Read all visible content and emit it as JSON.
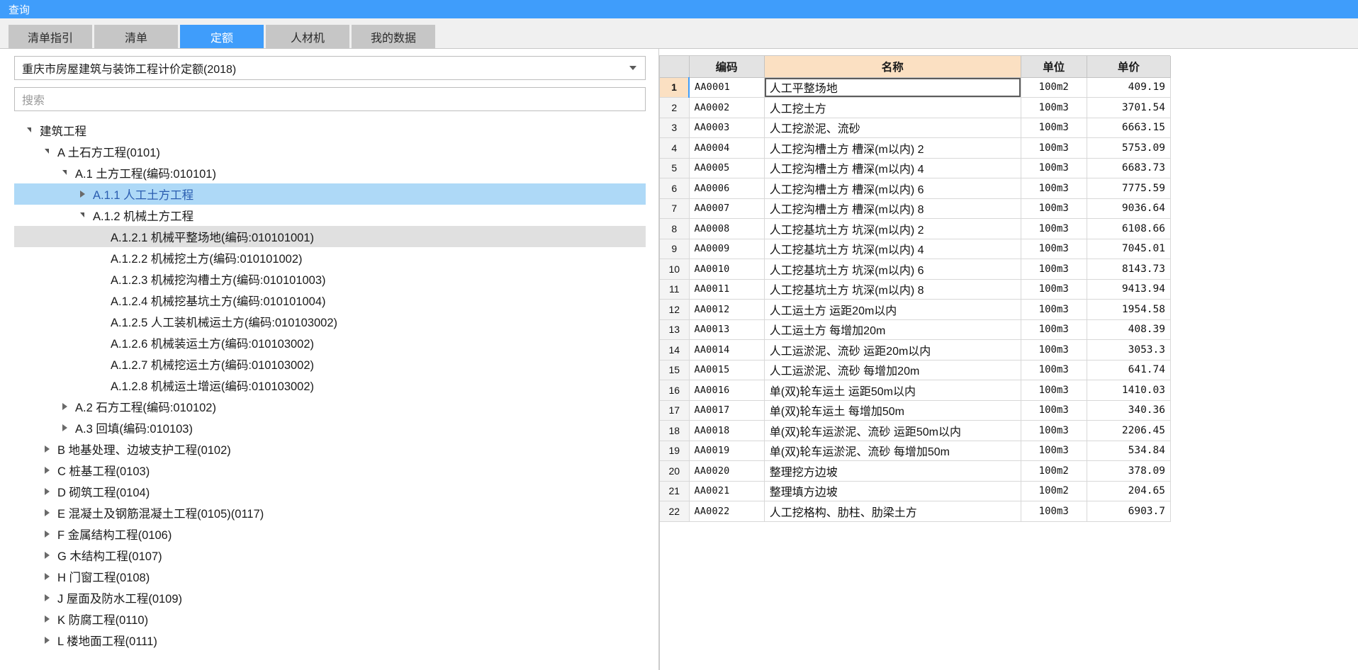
{
  "window": {
    "title": "查询"
  },
  "tabs": [
    {
      "label": "清单指引",
      "active": false
    },
    {
      "label": "清单",
      "active": false
    },
    {
      "label": "定额",
      "active": true
    },
    {
      "label": "人材机",
      "active": false
    },
    {
      "label": "我的数据",
      "active": false
    }
  ],
  "left": {
    "library_select": {
      "value": "重庆市房屋建筑与装饰工程计价定额(2018)",
      "caret_icon": "chevron-down-icon"
    },
    "search": {
      "value": "",
      "placeholder": "搜索"
    },
    "tree": [
      {
        "label": "建筑工程",
        "indent": 0,
        "twist": "down",
        "state": "normal"
      },
      {
        "label": "A 土石方工程(0101)",
        "indent": 1,
        "twist": "down",
        "state": "normal"
      },
      {
        "label": "A.1 土方工程(编码:010101)",
        "indent": 2,
        "twist": "down",
        "state": "normal"
      },
      {
        "label": "A.1.1 人工土方工程",
        "indent": 3,
        "twist": "right",
        "state": "selected"
      },
      {
        "label": "A.1.2 机械土方工程",
        "indent": 3,
        "twist": "down",
        "state": "normal"
      },
      {
        "label": "A.1.2.1 机械平整场地(编码:010101001)",
        "indent": 4,
        "twist": "none",
        "state": "highlight"
      },
      {
        "label": "A.1.2.2 机械挖土方(编码:010101002)",
        "indent": 4,
        "twist": "none",
        "state": "normal"
      },
      {
        "label": "A.1.2.3 机械挖沟槽土方(编码:010101003)",
        "indent": 4,
        "twist": "none",
        "state": "normal"
      },
      {
        "label": "A.1.2.4 机械挖基坑土方(编码:010101004)",
        "indent": 4,
        "twist": "none",
        "state": "normal"
      },
      {
        "label": "A.1.2.5 人工装机械运土方(编码:010103002)",
        "indent": 4,
        "twist": "none",
        "state": "normal"
      },
      {
        "label": "A.1.2.6 机械装运土方(编码:010103002)",
        "indent": 4,
        "twist": "none",
        "state": "normal"
      },
      {
        "label": "A.1.2.7 机械挖运土方(编码:010103002)",
        "indent": 4,
        "twist": "none",
        "state": "normal"
      },
      {
        "label": "A.1.2.8 机械运土增运(编码:010103002)",
        "indent": 4,
        "twist": "none",
        "state": "normal"
      },
      {
        "label": "A.2 石方工程(编码:010102)",
        "indent": 2,
        "twist": "right",
        "state": "normal"
      },
      {
        "label": "A.3 回填(编码:010103)",
        "indent": 2,
        "twist": "right",
        "state": "normal"
      },
      {
        "label": "B 地基处理、边坡支护工程(0102)",
        "indent": 1,
        "twist": "right",
        "state": "normal"
      },
      {
        "label": "C 桩基工程(0103)",
        "indent": 1,
        "twist": "right",
        "state": "normal"
      },
      {
        "label": "D 砌筑工程(0104)",
        "indent": 1,
        "twist": "right",
        "state": "normal"
      },
      {
        "label": "E 混凝土及钢筋混凝土工程(0105)(0117)",
        "indent": 1,
        "twist": "right",
        "state": "normal"
      },
      {
        "label": "F 金属结构工程(0106)",
        "indent": 1,
        "twist": "right",
        "state": "normal"
      },
      {
        "label": "G 木结构工程(0107)",
        "indent": 1,
        "twist": "right",
        "state": "normal"
      },
      {
        "label": "H 门窗工程(0108)",
        "indent": 1,
        "twist": "right",
        "state": "normal"
      },
      {
        "label": "J 屋面及防水工程(0109)",
        "indent": 1,
        "twist": "right",
        "state": "normal"
      },
      {
        "label": "K 防腐工程(0110)",
        "indent": 1,
        "twist": "right",
        "state": "normal"
      },
      {
        "label": "L 楼地面工程(0111)",
        "indent": 1,
        "twist": "right",
        "state": "normal"
      }
    ]
  },
  "grid": {
    "columns": [
      "",
      "编码",
      "名称",
      "单位",
      "单价"
    ],
    "selected_row": 1,
    "rows": [
      {
        "n": "1",
        "code": "AA0001",
        "name": "人工平整场地",
        "unit": "100m2",
        "price": "409.19"
      },
      {
        "n": "2",
        "code": "AA0002",
        "name": "人工挖土方",
        "unit": "100m3",
        "price": "3701.54"
      },
      {
        "n": "3",
        "code": "AA0003",
        "name": "人工挖淤泥、流砂",
        "unit": "100m3",
        "price": "6663.15"
      },
      {
        "n": "4",
        "code": "AA0004",
        "name": "人工挖沟槽土方 槽深(m以内) 2",
        "unit": "100m3",
        "price": "5753.09"
      },
      {
        "n": "5",
        "code": "AA0005",
        "name": "人工挖沟槽土方 槽深(m以内) 4",
        "unit": "100m3",
        "price": "6683.73"
      },
      {
        "n": "6",
        "code": "AA0006",
        "name": "人工挖沟槽土方 槽深(m以内) 6",
        "unit": "100m3",
        "price": "7775.59"
      },
      {
        "n": "7",
        "code": "AA0007",
        "name": "人工挖沟槽土方 槽深(m以内) 8",
        "unit": "100m3",
        "price": "9036.64"
      },
      {
        "n": "8",
        "code": "AA0008",
        "name": "人工挖基坑土方 坑深(m以内) 2",
        "unit": "100m3",
        "price": "6108.66"
      },
      {
        "n": "9",
        "code": "AA0009",
        "name": "人工挖基坑土方 坑深(m以内) 4",
        "unit": "100m3",
        "price": "7045.01"
      },
      {
        "n": "10",
        "code": "AA0010",
        "name": "人工挖基坑土方 坑深(m以内) 6",
        "unit": "100m3",
        "price": "8143.73"
      },
      {
        "n": "11",
        "code": "AA0011",
        "name": "人工挖基坑土方 坑深(m以内) 8",
        "unit": "100m3",
        "price": "9413.94"
      },
      {
        "n": "12",
        "code": "AA0012",
        "name": "人工运土方 运距20m以内",
        "unit": "100m3",
        "price": "1954.58"
      },
      {
        "n": "13",
        "code": "AA0013",
        "name": "人工运土方 每增加20m",
        "unit": "100m3",
        "price": "408.39"
      },
      {
        "n": "14",
        "code": "AA0014",
        "name": "人工运淤泥、流砂 运距20m以内",
        "unit": "100m3",
        "price": "3053.3"
      },
      {
        "n": "15",
        "code": "AA0015",
        "name": "人工运淤泥、流砂 每增加20m",
        "unit": "100m3",
        "price": "641.74"
      },
      {
        "n": "16",
        "code": "AA0016",
        "name": "单(双)轮车运土 运距50m以内",
        "unit": "100m3",
        "price": "1410.03"
      },
      {
        "n": "17",
        "code": "AA0017",
        "name": "单(双)轮车运土 每增加50m",
        "unit": "100m3",
        "price": "340.36"
      },
      {
        "n": "18",
        "code": "AA0018",
        "name": "单(双)轮车运淤泥、流砂 运距50m以内",
        "unit": "100m3",
        "price": "2206.45"
      },
      {
        "n": "19",
        "code": "AA0019",
        "name": "单(双)轮车运淤泥、流砂 每增加50m",
        "unit": "100m3",
        "price": "534.84"
      },
      {
        "n": "20",
        "code": "AA0020",
        "name": "整理挖方边坡",
        "unit": "100m2",
        "price": "378.09"
      },
      {
        "n": "21",
        "code": "AA0021",
        "name": "整理填方边坡",
        "unit": "100m2",
        "price": "204.65"
      },
      {
        "n": "22",
        "code": "AA0022",
        "name": "人工挖格构、肋柱、肋梁土方",
        "unit": "100m3",
        "price": "6903.7"
      }
    ]
  },
  "colors": {
    "accent": "#3f9dfb",
    "name_header": "#fbe0c2",
    "tree_selection": "#aed9f7",
    "tree_highlight": "#e0e0e0"
  }
}
